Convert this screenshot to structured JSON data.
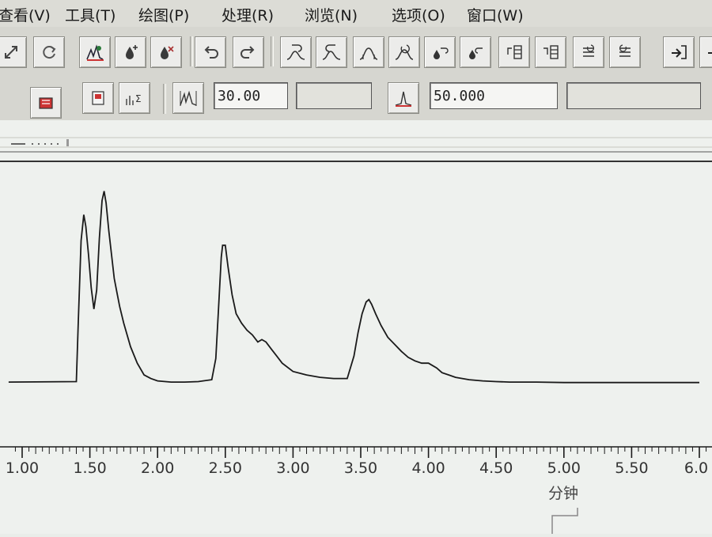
{
  "menu": [
    "查看(V)",
    "工具(T)",
    "绘图(P)",
    "处理(R)",
    "浏览(N)",
    "选项(O)",
    "窗口(W)"
  ],
  "toolbar2": {
    "field1_value": "30.00",
    "field2_value": "",
    "field3_value": "50.000",
    "field4_value": ""
  },
  "chart_data": {
    "type": "line",
    "xlabel": "分钟",
    "xlim": [
      0.9,
      6.0
    ],
    "ylim": [
      0,
      100
    ],
    "xticks": [
      "1.00",
      "1.50",
      "2.00",
      "2.50",
      "3.00",
      "3.50",
      "4.00",
      "4.50",
      "5.00",
      "5.50",
      "6.0"
    ],
    "series": [
      {
        "color": "#1a1a1a",
        "x": [
          0.9,
          1.4,
          1.415,
          1.435,
          1.455,
          1.47,
          1.49,
          1.51,
          1.53,
          1.55,
          1.57,
          1.59,
          1.605,
          1.62,
          1.64,
          1.66,
          1.68,
          1.7,
          1.72,
          1.75,
          1.8,
          1.85,
          1.9,
          1.95,
          2.0,
          2.1,
          2.2,
          2.3,
          2.4,
          2.43,
          2.45,
          2.47,
          2.48,
          2.5,
          2.52,
          2.55,
          2.58,
          2.62,
          2.66,
          2.7,
          2.74,
          2.77,
          2.8,
          2.84,
          2.88,
          2.92,
          3.0,
          3.1,
          3.2,
          3.3,
          3.4,
          3.45,
          3.48,
          3.51,
          3.54,
          3.56,
          3.58,
          3.61,
          3.65,
          3.7,
          3.75,
          3.8,
          3.85,
          3.9,
          3.95,
          4.0,
          4.03,
          4.06,
          4.1,
          4.15,
          4.2,
          4.3,
          4.4,
          4.5,
          4.6,
          4.8,
          5.0,
          5.2,
          5.4,
          5.6,
          5.8,
          6.0
        ],
        "y": [
          4.0,
          4.2,
          30,
          64,
          75,
          70,
          58,
          44,
          35,
          43,
          65,
          81,
          85,
          80,
          68,
          58,
          48,
          42,
          36,
          29,
          19,
          12,
          7,
          5.5,
          4.5,
          4.0,
          4.0,
          4.2,
          5,
          14,
          35,
          57,
          62,
          62,
          53,
          41,
          33,
          29,
          26,
          24,
          21,
          22,
          21,
          18,
          15,
          12,
          8.5,
          7,
          6,
          5.5,
          5.5,
          15,
          25,
          33,
          38,
          39,
          37,
          33,
          28,
          23,
          20,
          17,
          14.5,
          13,
          12,
          12,
          11,
          10,
          8,
          7,
          6,
          5,
          4.5,
          4.2,
          4.0,
          4.0,
          3.8,
          3.8,
          3.8,
          3.8,
          3.8,
          3.8
        ]
      }
    ]
  }
}
